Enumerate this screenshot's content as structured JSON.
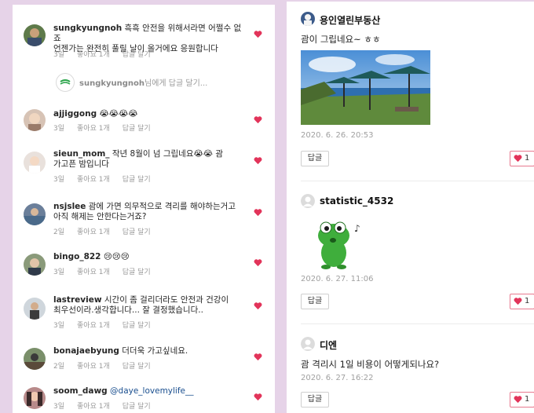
{
  "colors": {
    "background": "#e6d3e8",
    "heart": "#e2345a",
    "like_border": "#e8798f"
  },
  "comments": [
    {
      "user": "sungkyungnoh",
      "text": " 흑흑 안전을 위해서라면 어쩔수 없죠",
      "line2": "언젠가는 완전히 풀릴 날이 올거에요 응원합니다",
      "time": "3일",
      "likes": "좋아요 1개",
      "reply": "답글 달기"
    },
    {
      "user": "ajjiggong",
      "text": " 😭😭😭😭",
      "line2": "",
      "time": "3일",
      "likes": "좋아요 1개",
      "reply": "답글 달기"
    },
    {
      "user": "sieun_mom_",
      "text": " 작년 8월이 넘 그립네요😭😭 괌",
      "line2": "가고픈 밤입니다",
      "time": "3일",
      "likes": "좋아요 1개",
      "reply": "답글 달기"
    },
    {
      "user": "nsjslee",
      "text": " 괌에 가면 의무적으로 격리를 해야하는거고",
      "line2": "아직 해제는 안한다는거죠?",
      "time": "2일",
      "likes": "좋아요 1개",
      "reply": "답글 달기"
    },
    {
      "user": "bingo_822",
      "text": " 😢😢😢",
      "line2": "",
      "time": "3일",
      "likes": "좋아요 1개",
      "reply": "답글 달기"
    },
    {
      "user": "lastreview",
      "text": " 시간이 좀 걸리더라도 안전과 건강이",
      "line2": "최우선이라.생각합니다... 잘 결정했습니다..",
      "time": "3일",
      "likes": "좋아요 1개",
      "reply": "답글 달기"
    },
    {
      "user": "bonajaebyung",
      "text": " 더더욱 가고싶네요.",
      "line2": "",
      "time": "2일",
      "likes": "좋아요 1개",
      "reply": "답글 달기"
    },
    {
      "user": "soom_dawg",
      "mention": " @daye_lovemylife__",
      "line2": "",
      "time": "3일",
      "likes": "좋아요 1개",
      "reply": "답글 달기"
    }
  ],
  "reply_input": {
    "target_user": "sungkyungnoh",
    "placeholder_suffix": "님에게 답글 달기..."
  },
  "posts": [
    {
      "name": "용인열린부동산",
      "body": "괌이 그립네요~ ㅎㅎ",
      "date": "2020. 6. 26. 20:53",
      "reply_label": "답글",
      "like_count": "1"
    },
    {
      "name": "statistic_4532",
      "body": "",
      "date": "2020. 6. 27. 11:06",
      "reply_label": "답글",
      "like_count": "1"
    },
    {
      "name": "디엔",
      "body": "괌 격리시 1일 비용이 어떻게되나요?",
      "date": "2020. 6. 27. 16:22",
      "reply_label": "답글",
      "like_count": "1"
    }
  ],
  "icons": {
    "like": "heart-icon",
    "profile": "default-profile-icon",
    "music": "music-note-icon"
  }
}
